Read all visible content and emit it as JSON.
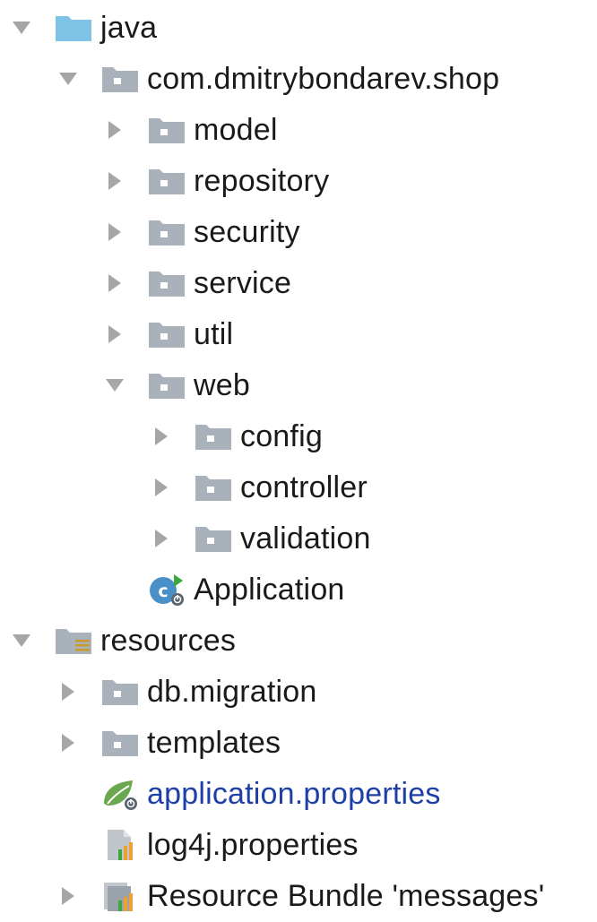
{
  "tree": {
    "nodes": [
      {
        "label": "java",
        "icon": "source-folder-icon",
        "expanded": true
      },
      {
        "label": "com.dmitrybondarev.shop",
        "icon": "package-icon",
        "expanded": true
      },
      {
        "label": "model",
        "icon": "package-icon",
        "expanded": false
      },
      {
        "label": "repository",
        "icon": "package-icon",
        "expanded": false
      },
      {
        "label": "security",
        "icon": "package-icon",
        "expanded": false
      },
      {
        "label": "service",
        "icon": "package-icon",
        "expanded": false
      },
      {
        "label": "util",
        "icon": "package-icon",
        "expanded": false
      },
      {
        "label": "web",
        "icon": "package-icon",
        "expanded": true
      },
      {
        "label": "config",
        "icon": "package-icon",
        "expanded": false
      },
      {
        "label": "controller",
        "icon": "package-icon",
        "expanded": false
      },
      {
        "label": "validation",
        "icon": "package-icon",
        "expanded": false
      },
      {
        "label": "Application",
        "icon": "spring-boot-application-icon"
      },
      {
        "label": "resources",
        "icon": "resources-folder-icon",
        "expanded": true
      },
      {
        "label": "db.migration",
        "icon": "package-icon",
        "expanded": false
      },
      {
        "label": "templates",
        "icon": "package-icon",
        "expanded": false
      },
      {
        "label": "application.properties",
        "icon": "spring-properties-icon"
      },
      {
        "label": "log4j.properties",
        "icon": "properties-file-icon"
      },
      {
        "label": "Resource Bundle 'messages'",
        "icon": "resource-bundle-icon",
        "expanded": false
      }
    ]
  },
  "colors": {
    "arrow": "#a6a6a6",
    "folder_gray": "#a9b2bb",
    "folder_blue": "#7ec3e6",
    "link_text": "#1f3fa8",
    "spring_green": "#6aa84f",
    "bar_orange": "#f0a030"
  }
}
